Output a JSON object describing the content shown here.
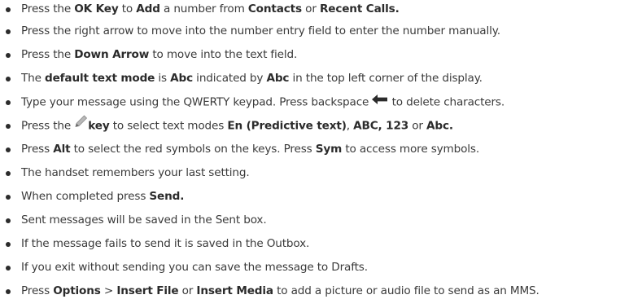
{
  "bullets": [
    {
      "t1": "Press the ",
      "b1": "OK Key",
      "t2": " to ",
      "b2": "Add",
      "t3": " a number from ",
      "b3": "Contacts",
      "t4": " or ",
      "b4": "Recent Calls."
    },
    {
      "t1": "Press the right arrow to move into the number entry field to enter the number manually."
    },
    {
      "t1": "Press the ",
      "b1": "Down Arrow",
      "t2": " to move into the text field."
    },
    {
      "t1": "The ",
      "b1": "default text mode",
      "t2": " is ",
      "b2": "Abc",
      "t3": " indicated by ",
      "b3": "Abc",
      "t4": " in the top left corner of the display."
    },
    {
      "t1": "Type your message using the QWERTY keypad. Press backspace ",
      "icon": "backspace-arrow-icon",
      "t2": " to delete characters."
    },
    {
      "t1": "Press the ",
      "icon": "pencil-icon",
      "b1": "key",
      "t2": " to select text modes ",
      "b2": "En (Predictive text)",
      "t3": ", ",
      "b3": "ABC, 123",
      "t4": " or ",
      "b4": "Abc."
    },
    {
      "t1": "Press ",
      "b1": "Alt",
      "t2": " to select the red symbols on the keys. Press ",
      "b2": "Sym",
      "t3": " to access more symbols."
    },
    {
      "t1": "The handset remembers your last setting."
    },
    {
      "t1": "When completed press ",
      "b1": "Send."
    },
    {
      "t1": "Sent messages will be saved in the Sent box."
    },
    {
      "t1": "If the message fails to send it is saved in the Outbox."
    },
    {
      "t1": "If you exit without sending you can save the message to Drafts."
    },
    {
      "t1": "Press ",
      "b1": "Options",
      "t2": " > ",
      "b2": "Insert File",
      "t3": " or ",
      "b3": "Insert Media",
      "t4": " to add a picture or audio file to send as an MMS."
    }
  ]
}
